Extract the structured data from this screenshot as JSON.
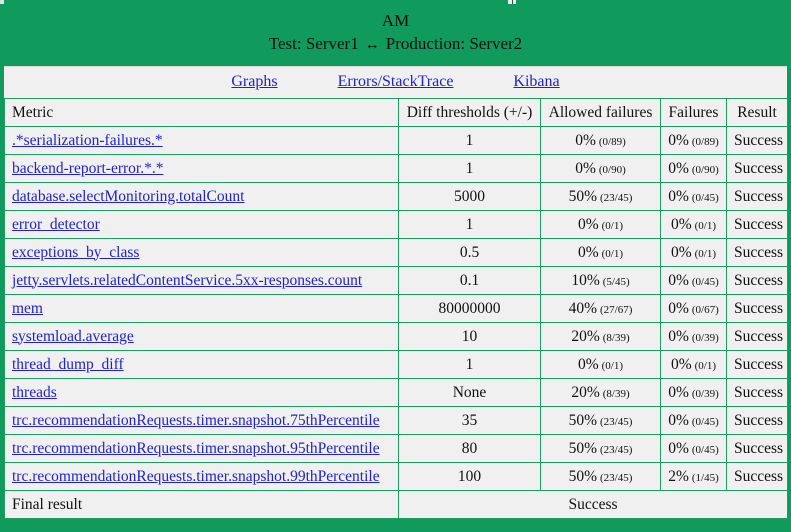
{
  "banner": {
    "title": "AM",
    "test_label": "Test: Server1",
    "arrow": "↔",
    "production_label": "Production: Server2"
  },
  "nav": {
    "links": [
      {
        "label": "Graphs"
      },
      {
        "label": "Errors/StackTrace"
      },
      {
        "label": "Kibana"
      }
    ]
  },
  "table": {
    "headers": {
      "metric": "Metric",
      "diff": "Diff thresholds (+/-)",
      "allowed": "Allowed failures",
      "failures": "Failures",
      "result": "Result"
    },
    "rows": [
      {
        "metric": ".*serialization-failures.*",
        "diff": "1",
        "allowed_pct": "0%",
        "allowed_frac": "(0/89)",
        "failures_pct": "0%",
        "failures_frac": "(0/89)",
        "result": "Success"
      },
      {
        "metric": "backend-report-error.*.*",
        "diff": "1",
        "allowed_pct": "0%",
        "allowed_frac": "(0/90)",
        "failures_pct": "0%",
        "failures_frac": "(0/90)",
        "result": "Success"
      },
      {
        "metric": "database.selectMonitoring.totalCount",
        "diff": "5000",
        "allowed_pct": "50%",
        "allowed_frac": "(23/45)",
        "failures_pct": "0%",
        "failures_frac": "(0/45)",
        "result": "Success"
      },
      {
        "metric": "error_detector",
        "diff": "1",
        "allowed_pct": "0%",
        "allowed_frac": "(0/1)",
        "failures_pct": "0%",
        "failures_frac": "(0/1)",
        "result": "Success"
      },
      {
        "metric": "exceptions_by_class",
        "diff": "0.5",
        "allowed_pct": "0%",
        "allowed_frac": "(0/1)",
        "failures_pct": "0%",
        "failures_frac": "(0/1)",
        "result": "Success"
      },
      {
        "metric": "jetty.servlets.relatedContentService.5xx-responses.count",
        "diff": "0.1",
        "allowed_pct": "10%",
        "allowed_frac": "(5/45)",
        "failures_pct": "0%",
        "failures_frac": "(0/45)",
        "result": "Success"
      },
      {
        "metric": "mem",
        "diff": "80000000",
        "allowed_pct": "40%",
        "allowed_frac": "(27/67)",
        "failures_pct": "0%",
        "failures_frac": "(0/67)",
        "result": "Success"
      },
      {
        "metric": "systemload.average",
        "diff": "10",
        "allowed_pct": "20%",
        "allowed_frac": "(8/39)",
        "failures_pct": "0%",
        "failures_frac": "(0/39)",
        "result": "Success"
      },
      {
        "metric": "thread_dump_diff",
        "diff": "1",
        "allowed_pct": "0%",
        "allowed_frac": "(0/1)",
        "failures_pct": "0%",
        "failures_frac": "(0/1)",
        "result": "Success"
      },
      {
        "metric": "threads",
        "diff": "None",
        "allowed_pct": "20%",
        "allowed_frac": "(8/39)",
        "failures_pct": "0%",
        "failures_frac": "(0/39)",
        "result": "Success"
      },
      {
        "metric": "trc.recommendationRequests.timer.snapshot.75thPercentile",
        "diff": "35",
        "allowed_pct": "50%",
        "allowed_frac": "(23/45)",
        "failures_pct": "0%",
        "failures_frac": "(0/45)",
        "result": "Success"
      },
      {
        "metric": "trc.recommendationRequests.timer.snapshot.95thPercentile",
        "diff": "80",
        "allowed_pct": "50%",
        "allowed_frac": "(23/45)",
        "failures_pct": "0%",
        "failures_frac": "(0/45)",
        "result": "Success"
      },
      {
        "metric": "trc.recommendationRequests.timer.snapshot.99thPercentile",
        "diff": "100",
        "allowed_pct": "50%",
        "allowed_frac": "(23/45)",
        "failures_pct": "2%",
        "failures_frac": "(1/45)",
        "result": "Success"
      }
    ],
    "final": {
      "label": "Final result",
      "value": "Success"
    }
  },
  "colors": {
    "brand_green": "#109a5c",
    "border_green": "#1d9c63",
    "link_blue": "#2222cc",
    "surface": "#f0f0f0"
  }
}
